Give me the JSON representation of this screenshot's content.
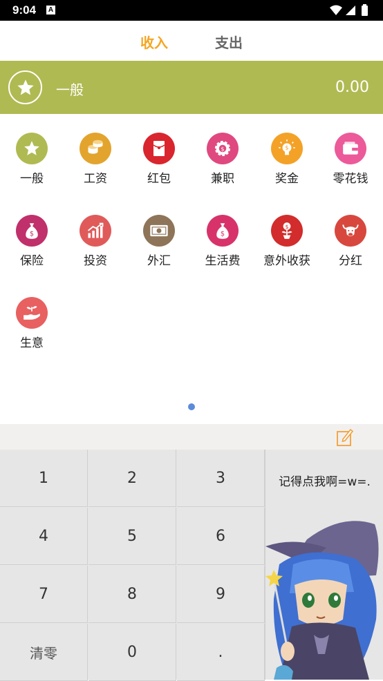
{
  "status": {
    "time": "9:04",
    "notif_icon": "A"
  },
  "tabs": {
    "income": "收入",
    "expense": "支出"
  },
  "selected": {
    "name": "一般",
    "amount": "0.00",
    "icon": "star-icon"
  },
  "categories": [
    {
      "label": "一般",
      "icon": "star-icon",
      "color": "#b0ba52"
    },
    {
      "label": "工资",
      "icon": "coins-icon",
      "color": "#e3a42d"
    },
    {
      "label": "红包",
      "icon": "red-envelope-icon",
      "color": "#d9252e"
    },
    {
      "label": "兼职",
      "icon": "gear-coin-icon",
      "color": "#e04880"
    },
    {
      "label": "奖金",
      "icon": "bulb-coin-icon",
      "color": "#f3a227"
    },
    {
      "label": "零花钱",
      "icon": "wallet-icon",
      "color": "#ec5a9a"
    },
    {
      "label": "保险",
      "icon": "money-bag-icon",
      "color": "#c0306a"
    },
    {
      "label": "投资",
      "icon": "chart-up-icon",
      "color": "#e05a5a"
    },
    {
      "label": "外汇",
      "icon": "banknote-icon",
      "color": "#8e7458"
    },
    {
      "label": "生活费",
      "icon": "money-bag-icon",
      "color": "#d7336a"
    },
    {
      "label": "意外收获",
      "icon": "money-plant-icon",
      "color": "#d22c2c"
    },
    {
      "label": "分红",
      "icon": "bull-icon",
      "color": "#d8473d"
    },
    {
      "label": "生意",
      "icon": "hand-sprout-icon",
      "color": "#e86060"
    }
  ],
  "keypad": {
    "k1": "1",
    "k2": "2",
    "k3": "3",
    "k4": "4",
    "k5": "5",
    "k6": "6",
    "k7": "7",
    "k8": "8",
    "k9": "9",
    "clear": "清零",
    "k0": "0",
    "dot": "."
  },
  "side_note": "记得点我啊=w=.",
  "colors": {
    "accent": "#f5a623",
    "bar": "#b0ba52",
    "page_dot": "#5b8bd9"
  }
}
